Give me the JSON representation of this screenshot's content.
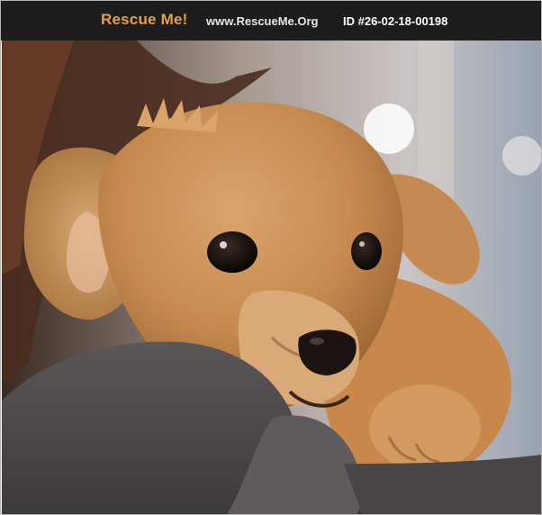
{
  "header": {
    "brand": "Rescue Me!",
    "site": "www.RescueMe.Org",
    "pet_id": "ID #26-02-18-00198"
  },
  "photo": {
    "subject": "puppy-photo"
  },
  "colors": {
    "header_bg": "#1d1d1d",
    "brand": "#e3a04b",
    "site_text": "#e6e6e6",
    "id_text": "#ffffff",
    "frame_border": "#b5b5b5"
  }
}
